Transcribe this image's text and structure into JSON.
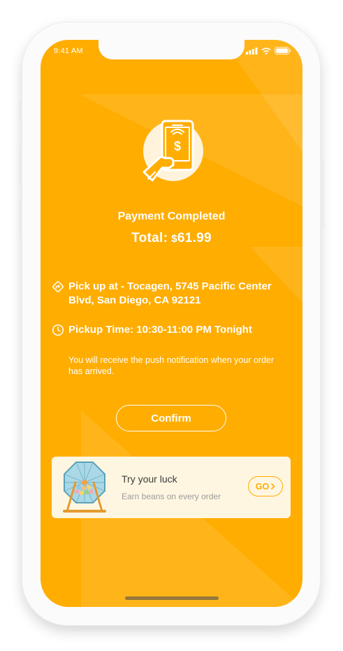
{
  "status_bar": {
    "time": "9:41 AM"
  },
  "payment": {
    "title": "Payment Completed",
    "total_label": "Total:",
    "currency": "$",
    "amount": "61.99"
  },
  "pickup": {
    "location": "Pick up at - Tocagen, 5745 Pacific Center Blvd, San Diego, CA 92121",
    "time": "Pickup Time: 10:30-11:00 PM Tonight"
  },
  "notice": "You will receive the push notification when your order has arrived.",
  "confirm_label": "Confirm",
  "promo": {
    "title": "Try your luck",
    "subtitle": "Earn beans on every order",
    "button_label": "GO"
  },
  "icons": {
    "hero": "hand-phone-payment-icon",
    "location": "directions-icon",
    "time": "clock-icon",
    "promo": "lottery-wheel-icon",
    "go": "chevron-right-icon"
  },
  "colors": {
    "primary": "#ffad00",
    "card_bg": "#fff6e1",
    "text_dark": "#3a3a3a",
    "text_muted": "#9b9b9b"
  }
}
